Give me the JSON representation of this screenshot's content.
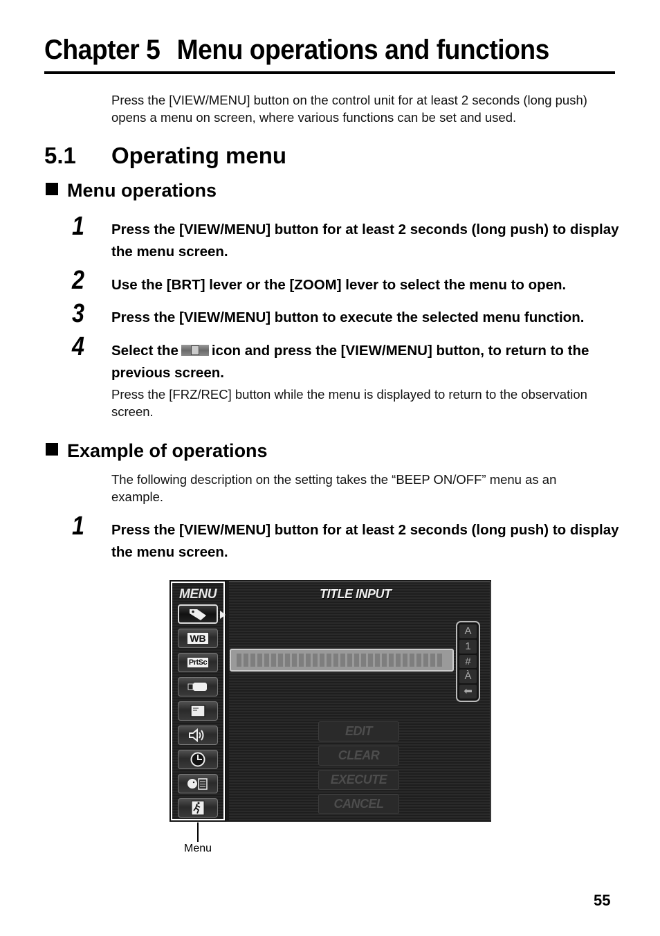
{
  "chapter": {
    "number": "Chapter 5",
    "title": "Menu operations and functions"
  },
  "intro": "Press the [VIEW/MENU] button on the control unit for at least 2 seconds (long push) opens a menu on screen, where various functions can be set and used.",
  "section": {
    "number": "5.1",
    "title": "Operating menu"
  },
  "menu_operations": {
    "heading": "Menu operations",
    "steps": [
      {
        "num": "1",
        "text": "Press the [VIEW/MENU] button for at least 2 seconds (long push) to display the menu screen."
      },
      {
        "num": "2",
        "text": "Use the [BRT] lever or the [ZOOM] lever to select the menu to open."
      },
      {
        "num": "3",
        "text": "Press the [VIEW/MENU] button to execute the selected menu function."
      },
      {
        "num": "4",
        "text_before": "Select the",
        "icon": "exit-icon",
        "text_after": "icon and press the [VIEW/MENU] button, to return to the previous screen.",
        "note": "Press the [FRZ/REC] button while the menu is displayed to return to the observation screen."
      }
    ]
  },
  "example": {
    "heading": "Example of operations",
    "description": "The following description on the setting takes the “BEEP ON/OFF” menu as an example.",
    "steps": [
      {
        "num": "1",
        "text": "Press the [VIEW/MENU] button for at least 2 seconds (long push) to display the menu screen."
      }
    ]
  },
  "screen": {
    "menu_title": "MENU",
    "menu_items": [
      {
        "icon": "tag-icon",
        "label": "",
        "selected": true
      },
      {
        "icon": "white-balance-icon",
        "label": "WB"
      },
      {
        "icon": "print-screen-icon",
        "label": "PrtSc"
      },
      {
        "icon": "usb-drive-icon",
        "label": ""
      },
      {
        "icon": "window-icon",
        "label": ""
      },
      {
        "icon": "speaker-icon",
        "label": ""
      },
      {
        "icon": "clock-icon",
        "label": ""
      },
      {
        "icon": "language-icon",
        "label": ""
      },
      {
        "icon": "exit-icon",
        "label": ""
      }
    ],
    "panel_title": "TITLE INPUT",
    "title_field_cells": 30,
    "char_modes": [
      "A",
      "1",
      "#",
      "À",
      "⬅"
    ],
    "actions": [
      "EDIT",
      "CLEAR",
      "EXECUTE",
      "CANCEL"
    ],
    "callout": "Menu"
  },
  "page_number": "55"
}
